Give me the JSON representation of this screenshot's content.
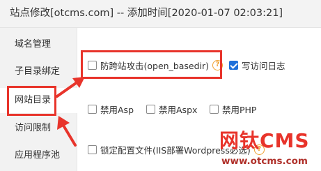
{
  "dialog": {
    "title": "站点修改[otcms.com] -- 添加时间[2020-01-07 02:03:21]"
  },
  "sidebar": {
    "items": [
      {
        "label": "域名管理"
      },
      {
        "label": "子目录绑定"
      },
      {
        "label": "网站目录",
        "active": true
      },
      {
        "label": "访问限制"
      },
      {
        "label": "应用程序池"
      }
    ]
  },
  "main": {
    "anti_attack": {
      "label": "防跨站攻击(open_basedir)",
      "checked": false
    },
    "write_log": {
      "label": "写访问日志",
      "checked": true
    },
    "disable_asp": {
      "label": "禁用Asp",
      "checked": false
    },
    "disable_aspx": {
      "label": "禁用Aspx",
      "checked": false
    },
    "disable_php": {
      "label": "禁用PHP",
      "checked": false
    },
    "lock_config": {
      "label": "锁定配置文件(IIS部署Wordpress必选)",
      "checked": false
    }
  },
  "icons": {
    "help": "question-circle-icon"
  },
  "watermark": {
    "logo": "网钛CMS",
    "url": "www.otcms.com"
  },
  "colors": {
    "highlight": "#e8342b",
    "checkbox_on": "#1e6fd9",
    "help": "#f0a030"
  }
}
